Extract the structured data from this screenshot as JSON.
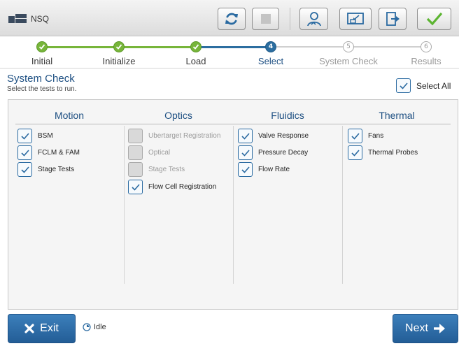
{
  "app": {
    "title": "NSQ"
  },
  "toolbar": {
    "buttons": [
      {
        "name": "refresh",
        "icon": "refresh-icon",
        "enabled": true
      },
      {
        "name": "stop",
        "icon": "stop-icon",
        "enabled": false
      },
      {
        "name": "user",
        "icon": "user-icon",
        "enabled": true
      },
      {
        "name": "minimize",
        "icon": "minimize-window-icon",
        "enabled": true
      },
      {
        "name": "logout",
        "icon": "logout-icon",
        "enabled": true
      },
      {
        "name": "confirm",
        "icon": "checkmark-icon",
        "enabled": true
      }
    ]
  },
  "stepper": {
    "steps": [
      {
        "label": "Initial",
        "marker": "",
        "state": "done"
      },
      {
        "label": "Initialize",
        "marker": "",
        "state": "done"
      },
      {
        "label": "Load",
        "marker": "",
        "state": "done"
      },
      {
        "label": "Select",
        "marker": "4",
        "state": "active"
      },
      {
        "label": "System Check",
        "marker": "5",
        "state": "todo"
      },
      {
        "label": "Results",
        "marker": "6",
        "state": "todo"
      }
    ]
  },
  "section": {
    "title": "System Check",
    "subtitle": "Select the tests to run.",
    "select_all_label": "Select All",
    "select_all_checked": true
  },
  "columns": [
    {
      "title": "Motion",
      "items": [
        {
          "label": "BSM",
          "checked": true,
          "enabled": true
        },
        {
          "label": "FCLM & FAM",
          "checked": true,
          "enabled": true
        },
        {
          "label": "Stage Tests",
          "checked": true,
          "enabled": true
        }
      ]
    },
    {
      "title": "Optics",
      "items": [
        {
          "label": "Ubertarget Registration",
          "checked": false,
          "enabled": false
        },
        {
          "label": "Optical",
          "checked": false,
          "enabled": false
        },
        {
          "label": "Stage Tests",
          "checked": false,
          "enabled": false
        },
        {
          "label": "Flow Cell Registration",
          "checked": true,
          "enabled": true
        }
      ]
    },
    {
      "title": "Fluidics",
      "items": [
        {
          "label": "Valve Response",
          "checked": true,
          "enabled": true
        },
        {
          "label": "Pressure Decay",
          "checked": true,
          "enabled": true
        },
        {
          "label": "Flow Rate",
          "checked": true,
          "enabled": true
        }
      ]
    },
    {
      "title": "Thermal",
      "items": [
        {
          "label": "Fans",
          "checked": true,
          "enabled": true
        },
        {
          "label": "Thermal Probes",
          "checked": true,
          "enabled": true
        }
      ]
    }
  ],
  "footer": {
    "exit_label": "Exit",
    "next_label": "Next",
    "status_text": "Idle"
  },
  "colors": {
    "accent": "#2c6ea0",
    "button_blue": "#235d96",
    "step_done": "#77b53a",
    "confirm_green": "#5cb531"
  }
}
